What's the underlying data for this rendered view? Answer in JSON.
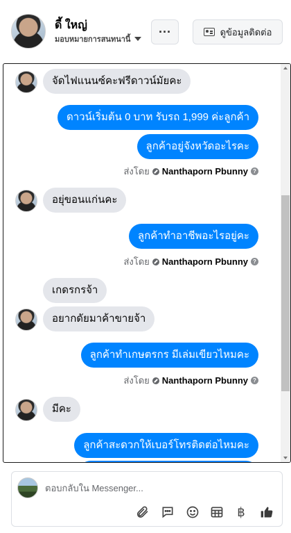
{
  "header": {
    "name": "ดี้ ใหญ่",
    "assign_label": "มอบหมายการสนทนานี้",
    "more_label": "···",
    "contact_label": "ดูข้อมูลติดต่อ"
  },
  "messages": [
    {
      "dir": "in",
      "text": "จัดไฟแนนซ์คะฟรีดาวน์มัยคะ"
    },
    {
      "dir": "out",
      "text": "ดาวน์เริ่มต้น 0 บาท รับรถ 1,999 ค่ะลูกค้า"
    },
    {
      "dir": "out",
      "text": "ลูกค้าอยู่จังหวัดอะไรคะ"
    },
    {
      "dir": "sent",
      "prefix": "ส่งโดย",
      "name": "Nanthaporn Pbunny"
    },
    {
      "dir": "in",
      "text": "อยุ่ขอนแก่นคะ"
    },
    {
      "dir": "out",
      "text": "ลูกค้าทำอาชีพอะไรอยู่คะ"
    },
    {
      "dir": "sent",
      "prefix": "ส่งโดย",
      "name": "Nanthaporn Pbunny"
    },
    {
      "dir": "in",
      "text": "เกดรกรจ้า"
    },
    {
      "dir": "in",
      "text": "อยากดัยมาค้าขายจ้า"
    },
    {
      "dir": "out",
      "text": "ลูกค้าทำเกษตรกร มีเล่มเขียวไหมคะ"
    },
    {
      "dir": "sent",
      "prefix": "ส่งโดย",
      "name": "Nanthaporn Pbunny"
    },
    {
      "dir": "in",
      "text": "มีคะ"
    },
    {
      "dir": "out",
      "text": "ลูกค้าสะดวกให้เบอร์โทรติดต่อไหมคะ"
    }
  ],
  "composer": {
    "placeholder": "ตอบกลับใน Messenger...",
    "tools": [
      "paperclip-icon",
      "speech-bubble-icon",
      "emoji-icon",
      "table-icon",
      "baht-icon",
      "like-icon"
    ],
    "baht_label": "฿"
  },
  "colors": {
    "outgoing_bubble": "#0084ff",
    "incoming_bubble": "#e4e6eb",
    "meta_text": "#65676b"
  }
}
